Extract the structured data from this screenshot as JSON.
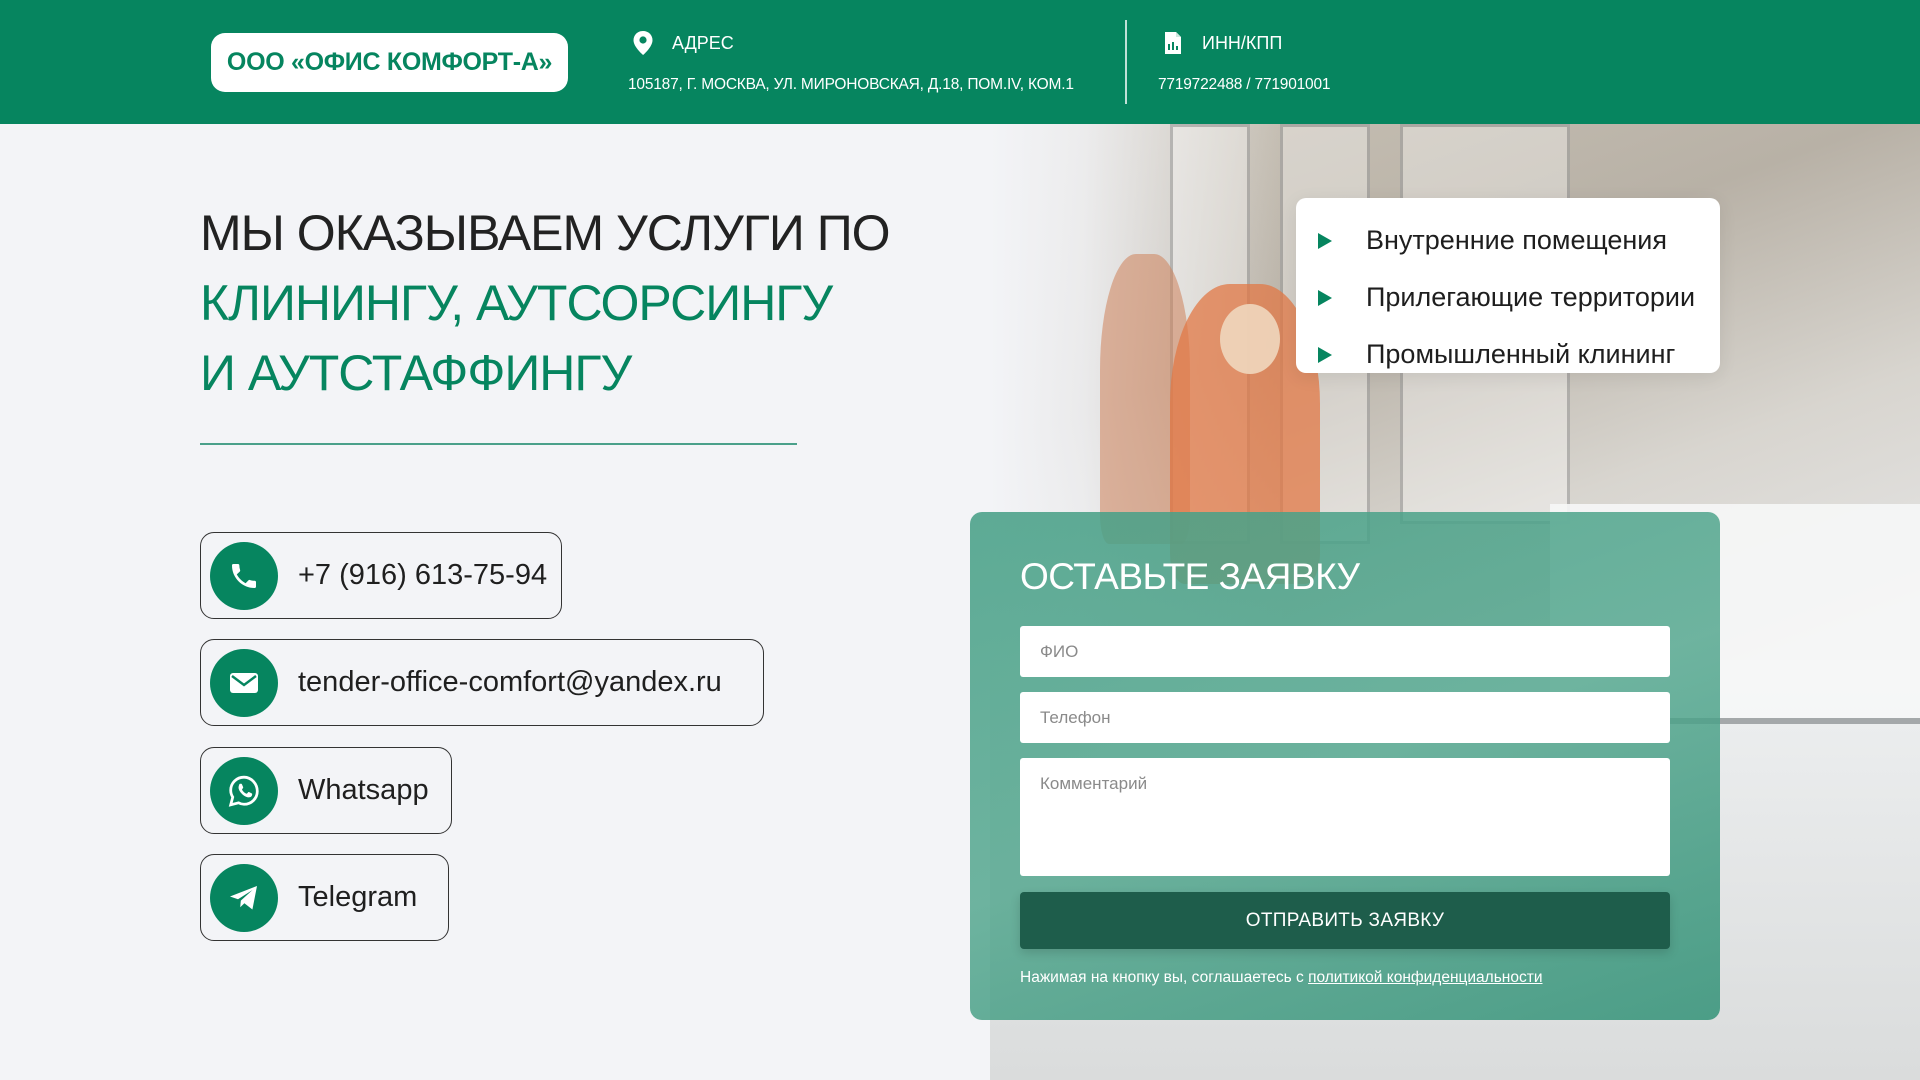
{
  "header": {
    "logo": "ООО «ОФИС КОМФОРТ-А»",
    "address_title": "АДРЕС",
    "address_value": "105187, Г. МОСКВА, УЛ. МИРОНОВСКАЯ, Д.18, ПОМ.IV, КОМ.1",
    "inn_title": "ИНН/КПП",
    "inn_value": "7719722488 / 771901001",
    "icons": [
      "location-pin-icon",
      "document-icon"
    ]
  },
  "hero": {
    "line1": "МЫ ОКАЗЫВАЕМ УСЛУГИ ПО",
    "line2": "КЛИНИНГУ, АУТСОРСИНГУ",
    "line3": "И АУТСТАФФИНГУ"
  },
  "contacts": [
    {
      "icon": "phone-icon",
      "label": "+7 (916) 613-75-94"
    },
    {
      "icon": "mail-icon",
      "label": "tender-office-comfort@yandex.ru"
    },
    {
      "icon": "whatsapp-icon",
      "label": "Whatsapp"
    },
    {
      "icon": "telegram-icon",
      "label": "Telegram"
    }
  ],
  "services": [
    "Внутренние помещения",
    "Прилегающие территории",
    "Промышленный клининг"
  ],
  "form": {
    "title": "ОСТАВЬТЕ ЗАЯВКУ",
    "name_placeholder": "ФИО",
    "phone_placeholder": "Телефон",
    "comment_placeholder": "Комментарий",
    "submit_label": "ОТПРАВИТЬ ЗАЯВКУ",
    "consent_text": "Нажимая на кнопку вы, соглашаетесь с ",
    "consent_link": "политикой конфиденциальности"
  },
  "colors": {
    "brand": "#06855f",
    "button_dark": "#1e5d4b",
    "background": "#f3f4f7"
  }
}
